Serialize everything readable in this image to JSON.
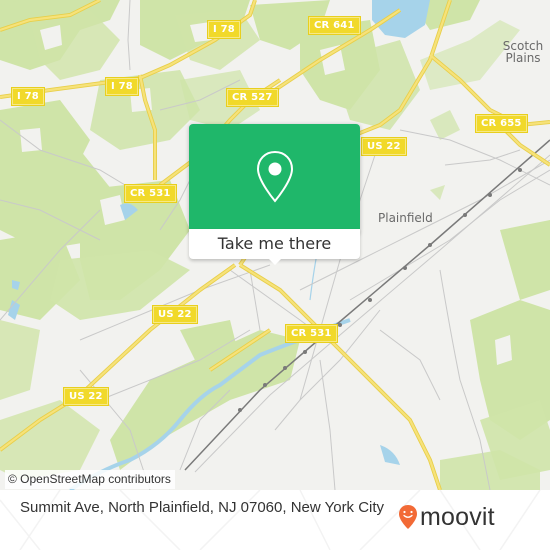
{
  "map": {
    "road_labels": [
      {
        "id": "i78-top",
        "label": "I 78"
      },
      {
        "id": "i78-mid",
        "label": "I 78"
      },
      {
        "id": "i78-left",
        "label": "I 78"
      },
      {
        "id": "cr641",
        "label": "CR 641"
      },
      {
        "id": "cr527",
        "label": "CR 527"
      },
      {
        "id": "cr531-top",
        "label": "CR 531"
      },
      {
        "id": "us22-right",
        "label": "US 22"
      },
      {
        "id": "cr655",
        "label": "CR 655"
      },
      {
        "id": "us22-mid",
        "label": "US 22"
      },
      {
        "id": "us22-left",
        "label": "US 22"
      },
      {
        "id": "cr531-bottom",
        "label": "CR 531"
      }
    ],
    "place_labels": [
      {
        "id": "scotch-plains",
        "line1": "Scotch",
        "line2": "Plains"
      },
      {
        "id": "plainfield",
        "line1": "Plainfield"
      }
    ],
    "colors": {
      "background": "#f2f2ef",
      "park": "#cfe4a8",
      "water": "#a6d3ea",
      "highway": "#f3dc5c",
      "shield": "#f1d92a",
      "rail": "#7a7a7a",
      "minor_road": "#c9c9c9"
    }
  },
  "popup": {
    "icon": "map-pin-icon",
    "button_label": "Take me there",
    "color": "#1fb76a"
  },
  "attribution": "© OpenStreetMap contributors",
  "footer": {
    "address": "Summit Ave, North Plainfield, NJ 07060, New York City",
    "brand": "moovit",
    "brand_color": "#f26a36"
  }
}
